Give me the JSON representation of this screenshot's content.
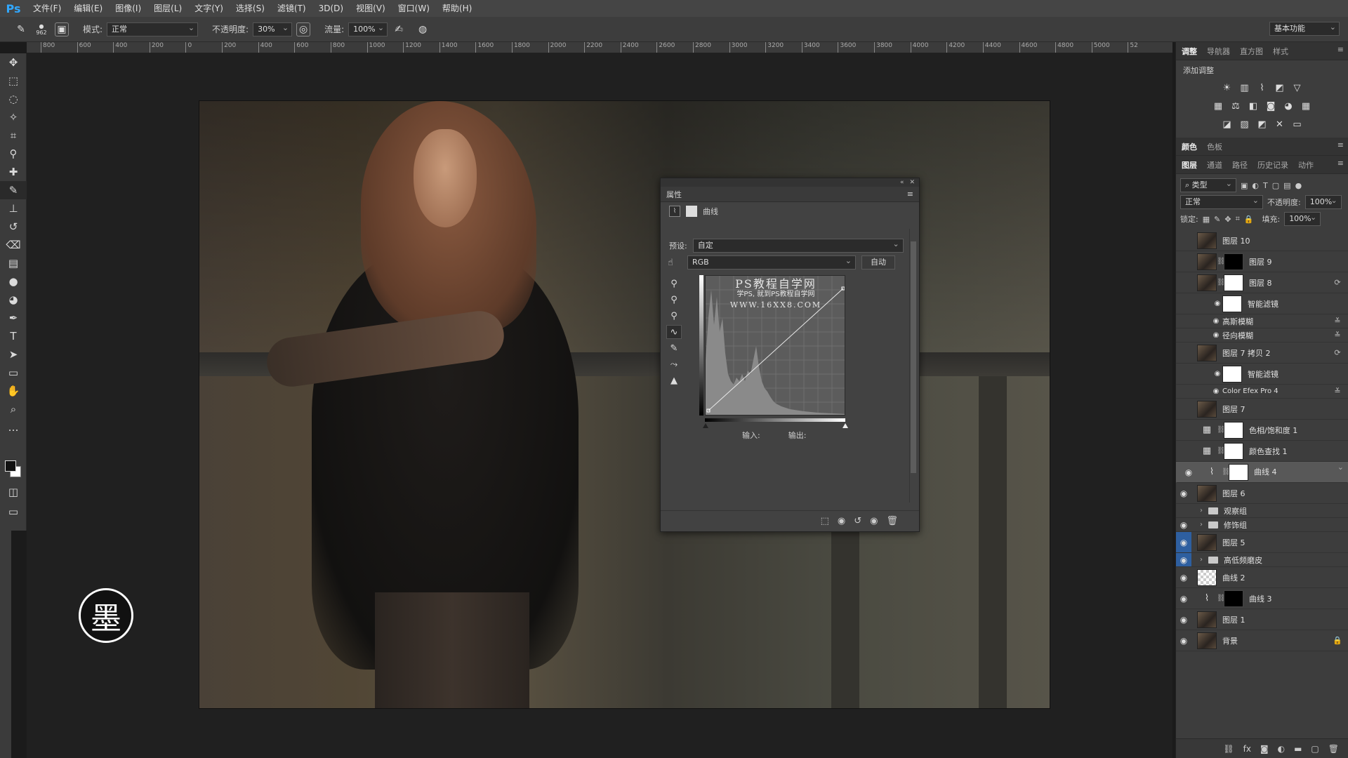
{
  "app": {
    "logo": "Ps"
  },
  "menu": [
    "文件(F)",
    "编辑(E)",
    "图像(I)",
    "图层(L)",
    "文字(Y)",
    "选择(S)",
    "滤镜(T)",
    "3D(D)",
    "视图(V)",
    "窗口(W)",
    "帮助(H)"
  ],
  "options": {
    "brush_size": "962",
    "mode_label": "模式:",
    "mode_value": "正常",
    "opacity_label": "不透明度:",
    "opacity_value": "30%",
    "flow_label": "流量:",
    "flow_value": "100%",
    "workspace": "基本功能"
  },
  "ruler": {
    "ticks": [
      "800",
      "600",
      "400",
      "200",
      "0",
      "200",
      "400",
      "600",
      "800",
      "1000",
      "1200",
      "1400",
      "1600",
      "1800",
      "2000",
      "2200",
      "2400",
      "2600",
      "2800",
      "3000",
      "3200",
      "3400",
      "3600",
      "3800",
      "4000",
      "4200",
      "4400",
      "4600",
      "4800",
      "5000",
      "52"
    ]
  },
  "canvas": {
    "seal_char": "墨"
  },
  "properties": {
    "tab": "属性",
    "type_label": "曲线",
    "preset_label": "预设:",
    "preset_value": "自定",
    "channel_value": "RGB",
    "auto_button": "自动",
    "input_label": "输入:",
    "output_label": "输出:",
    "watermark": {
      "line1": "PS教程自学网",
      "line2": "学PS, 就到PS教程自学网",
      "line3": "WWW.16XX8.COM"
    }
  },
  "right_panel": {
    "top_tabs": [
      "调整",
      "导航器",
      "直方图",
      "样式"
    ],
    "add_adjust_label": "添加调整",
    "color_tabs": [
      "颜色",
      "色板"
    ],
    "layer_tabs": [
      "图层",
      "通道",
      "路径",
      "历史记录",
      "动作"
    ],
    "filter_kind": "类型",
    "blend_mode": "正常",
    "opacity_label": "不透明度:",
    "opacity_value": "100%",
    "lock_label": "锁定:",
    "fill_label": "填充:",
    "fill_value": "100%"
  },
  "layers": [
    {
      "name": "图层 10"
    },
    {
      "name": "图层 9"
    },
    {
      "name": "图层 8"
    },
    {
      "name": "智能滤镜"
    },
    {
      "name": "高斯模糊"
    },
    {
      "name": "径向模糊"
    },
    {
      "name": "图层 7 拷贝 2"
    },
    {
      "name": "智能滤镜"
    },
    {
      "name": "Color Efex Pro 4"
    },
    {
      "name": "图层 7"
    },
    {
      "name": "色相/饱和度 1"
    },
    {
      "name": "颜色查找 1"
    },
    {
      "name": "曲线 4"
    },
    {
      "name": "图层 6"
    },
    {
      "name": "观察组"
    },
    {
      "name": "修饰组"
    },
    {
      "name": "图层 5"
    },
    {
      "name": "高低频磨皮"
    },
    {
      "name": "曲线 2"
    },
    {
      "name": "曲线 3"
    },
    {
      "name": "图层 1"
    },
    {
      "name": "背景"
    }
  ]
}
